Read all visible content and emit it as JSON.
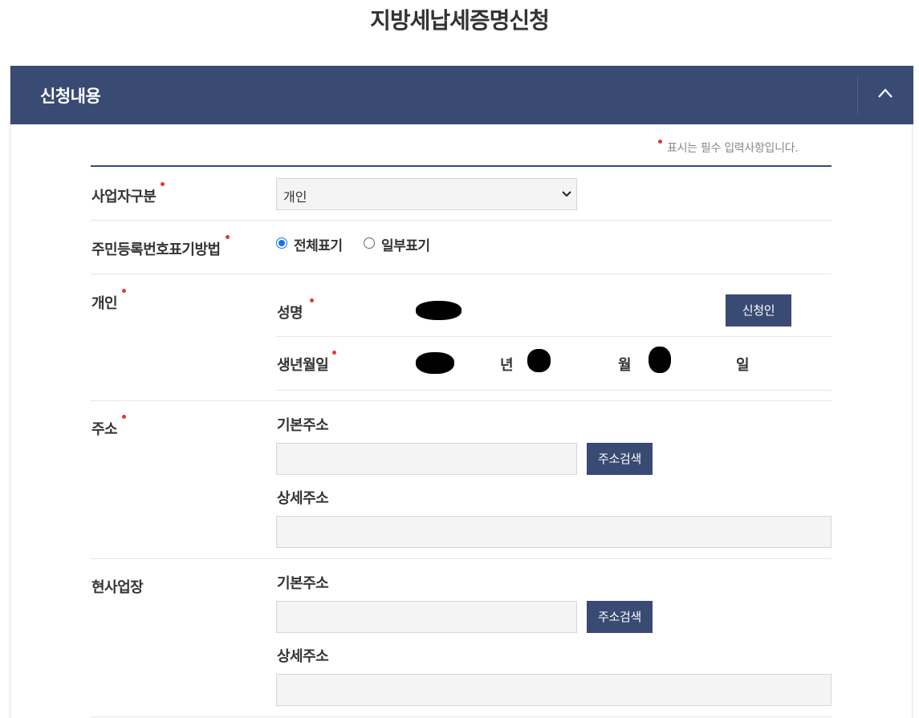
{
  "page": {
    "title": "지방세납세증명신청"
  },
  "section": {
    "title": "신청내용",
    "collapse_icon": "chevron-up-icon",
    "required_note": "표시는 필수 입력사항입니다."
  },
  "colors": {
    "primary": "#394a73",
    "required_dot": "#e03a3a",
    "radio_accent": "#1a73e8"
  },
  "fields": {
    "business_type": {
      "label": "사업자구분",
      "value": "개인",
      "icon": "chevron-down-icon"
    },
    "rrn_display": {
      "label": "주민등록번호표기방법",
      "options": [
        {
          "label": "전체표기",
          "checked": true
        },
        {
          "label": "일부표기",
          "checked": false
        }
      ]
    },
    "individual": {
      "label": "개인",
      "name_label": "성명",
      "applicant_button": "신청인",
      "birth_label": "생년월일",
      "year_unit": "년",
      "month_unit": "월",
      "day_unit": "일"
    },
    "address": {
      "label": "주소",
      "basic_label": "기본주소",
      "search_button": "주소검색",
      "detail_label": "상세주소",
      "basic_value": "",
      "detail_value": ""
    },
    "business_site": {
      "label": "현사업장",
      "basic_label": "기본주소",
      "search_button": "주소검색",
      "detail_label": "상세주소",
      "basic_value": "",
      "detail_value": ""
    }
  }
}
